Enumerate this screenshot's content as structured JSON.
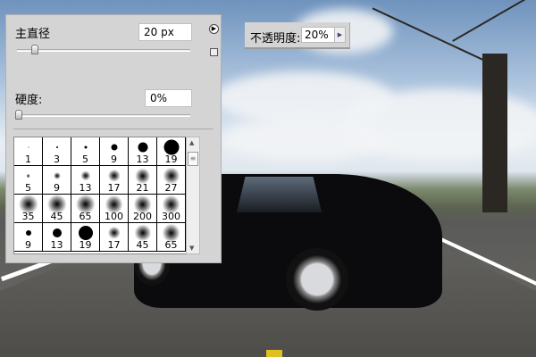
{
  "brush_panel": {
    "diameter_label": "主直径",
    "diameter_value": "20 px",
    "diameter_fraction": 0.08,
    "hardness_label": "硬度:",
    "hardness_value": "0%",
    "hardness_fraction": 0.0,
    "menu_icon": "play-circle-icon",
    "new_preset_icon": "new-preset-icon",
    "brushes": [
      {
        "size": "1",
        "hard": true
      },
      {
        "size": "3",
        "hard": true
      },
      {
        "size": "5",
        "hard": true
      },
      {
        "size": "9",
        "hard": true
      },
      {
        "size": "13",
        "hard": true
      },
      {
        "size": "19",
        "hard": true
      },
      {
        "size": "5",
        "hard": false
      },
      {
        "size": "9",
        "hard": false
      },
      {
        "size": "13",
        "hard": false
      },
      {
        "size": "17",
        "hard": false
      },
      {
        "size": "21",
        "hard": false
      },
      {
        "size": "27",
        "hard": false
      },
      {
        "size": "35",
        "hard": false
      },
      {
        "size": "45",
        "hard": false
      },
      {
        "size": "65",
        "hard": false
      },
      {
        "size": "100",
        "hard": false
      },
      {
        "size": "200",
        "hard": false
      },
      {
        "size": "300",
        "hard": false
      },
      {
        "size": "9",
        "hard": true
      },
      {
        "size": "13",
        "hard": true
      },
      {
        "size": "19",
        "hard": true
      },
      {
        "size": "17",
        "hard": false
      },
      {
        "size": "45",
        "hard": false
      },
      {
        "size": "65",
        "hard": false
      }
    ]
  },
  "opacity": {
    "label": "不透明度:",
    "value": "20%"
  }
}
